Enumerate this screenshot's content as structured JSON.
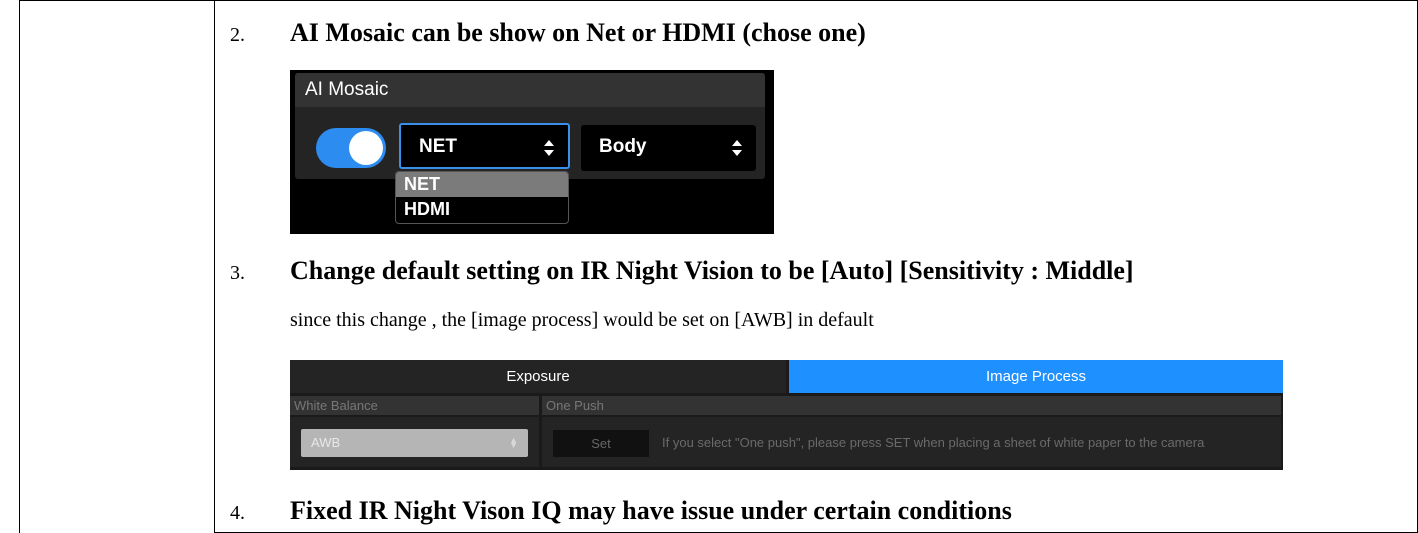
{
  "items": [
    {
      "number": "2.",
      "heading": "AI Mosaic can be show on Net or HDMI (chose one)"
    },
    {
      "number": "3.",
      "heading": "Change default setting on IR Night Vision to be [Auto] [Sensitivity : Middle]",
      "note": "since this change , the [image process] would be set on [AWB] in default"
    },
    {
      "number": "4.",
      "heading": "Fixed IR Night Vison IQ may have issue under certain conditions"
    }
  ],
  "mosaic_panel": {
    "title": "AI Mosaic",
    "toggle_on": true,
    "output_select": "NET",
    "target_select": "Body",
    "dropdown_options": [
      "NET",
      "HDMI"
    ],
    "dropdown_selected": "NET",
    "accent": "#2d8cf0"
  },
  "settings_panel": {
    "tabs": [
      "Exposure",
      "Image Process"
    ],
    "active_tab": "Image Process",
    "white_balance_label": "White Balance",
    "white_balance_value": "AWB",
    "one_push_label": "One Push",
    "set_button": "Set",
    "hint": "If you select \"One push\", please press SET when placing a sheet of white paper to the camera",
    "accent": "#1e90ff"
  }
}
